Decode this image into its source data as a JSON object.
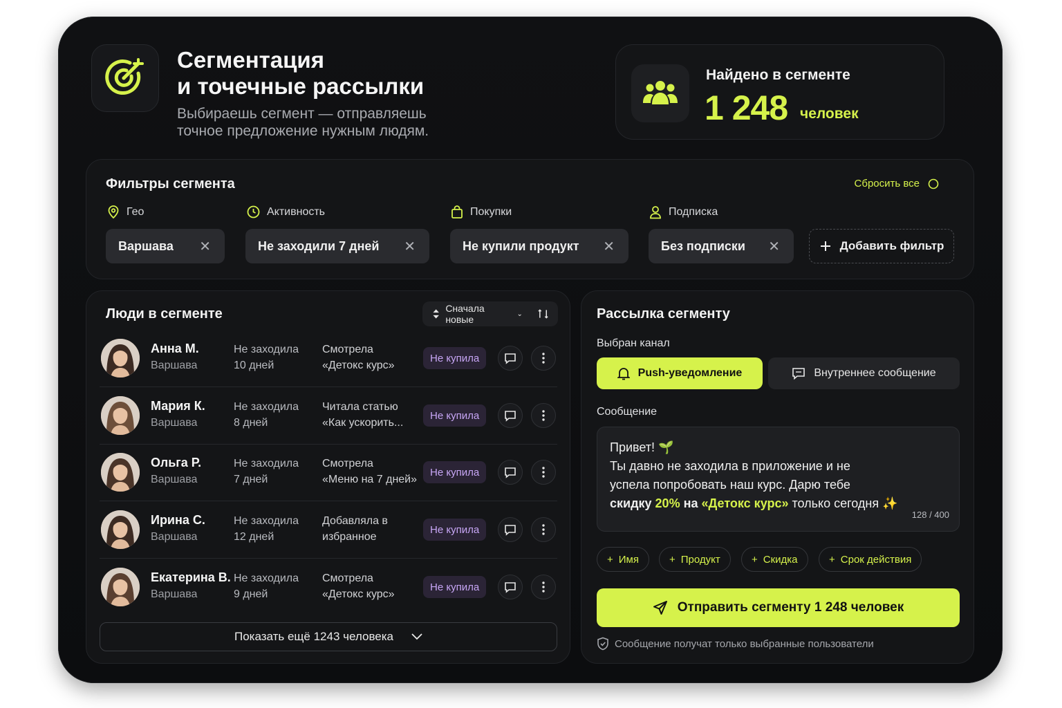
{
  "hero": {
    "title_line1": "Сегментация",
    "title_line2": "и точечные рассылки",
    "subtitle_line1": "Выбираешь сегмент — отправляешь",
    "subtitle_line2": "точное предложение нужным людям."
  },
  "stat": {
    "label": "Найдено в сегменте",
    "value": "1 248",
    "unit": "человек"
  },
  "filters": {
    "title": "Фильтры сегмента",
    "reset_label": "Сбросить все",
    "groups": [
      {
        "label": "Гео",
        "icon": "map-pin-icon",
        "chip": "Варшава"
      },
      {
        "label": "Активность",
        "icon": "clock-icon",
        "chip": "Не заходили 7 дней"
      },
      {
        "label": "Покупки",
        "icon": "shopping-bag-icon",
        "chip": "Не купили продукт"
      },
      {
        "label": "Подписка",
        "icon": "user-icon",
        "chip": "Без подписки"
      }
    ],
    "add_label": "Добавить фильтр"
  },
  "people": {
    "title": "Люди в сегменте",
    "sort_label": "Сначала новые",
    "rows": [
      {
        "name": "Анна М.",
        "city": "Варшава",
        "act1": "Не заходила",
        "act2": "10 дней",
        "note1": "Смотрела",
        "note2": "«Детокс курс»",
        "badge": "Не купила"
      },
      {
        "name": "Мария К.",
        "city": "Варшава",
        "act1": "Не заходила",
        "act2": "8 дней",
        "note1": "Читала статью",
        "note2": "«Как ускорить...",
        "badge": "Не купила"
      },
      {
        "name": "Ольга Р.",
        "city": "Варшава",
        "act1": "Не заходила",
        "act2": "7 дней",
        "note1": "Смотрела",
        "note2": "«Меню на 7 дней»",
        "badge": "Не купила"
      },
      {
        "name": "Ирина С.",
        "city": "Варшава",
        "act1": "Не заходила",
        "act2": "12 дней",
        "note1": "Добавляла в",
        "note2": "избранное",
        "badge": "Не купила"
      },
      {
        "name": "Екатерина В.",
        "city": "Варшава",
        "act1": "Не заходила",
        "act2": "9 дней",
        "note1": "Смотрела",
        "note2": "«Детокс курс»",
        "badge": "Не купила"
      }
    ],
    "show_more": "Показать ещё 1243 человека"
  },
  "mail": {
    "title": "Рассылка сегменту",
    "channel_label": "Выбран канал",
    "channel_push": "Push-уведомление",
    "channel_inner": "Внутреннее сообщение",
    "message_label": "Сообщение",
    "msg_line1": "Привет!",
    "msg_line2": "Ты давно не заходила в приложение и не",
    "msg_line3": "успела попробовать наш курс. Дарю тебе",
    "msg_word_discount": "скидку",
    "msg_percent": "20%",
    "msg_on": "на",
    "msg_product": "«Детокс курс»",
    "msg_tail": "только сегодня",
    "counter": "128 / 400",
    "variables": [
      "Имя",
      "Продукт",
      "Скидка",
      "Срок действия"
    ],
    "send_label": "Отправить сегменту 1 248 человек",
    "footnote": "Сообщение получат только выбранные пользователи"
  },
  "colors": {
    "accent": "#d6f24b",
    "badge_text": "#c7a6f5",
    "badge_bg": "#2b2436",
    "panel": "#141517"
  }
}
